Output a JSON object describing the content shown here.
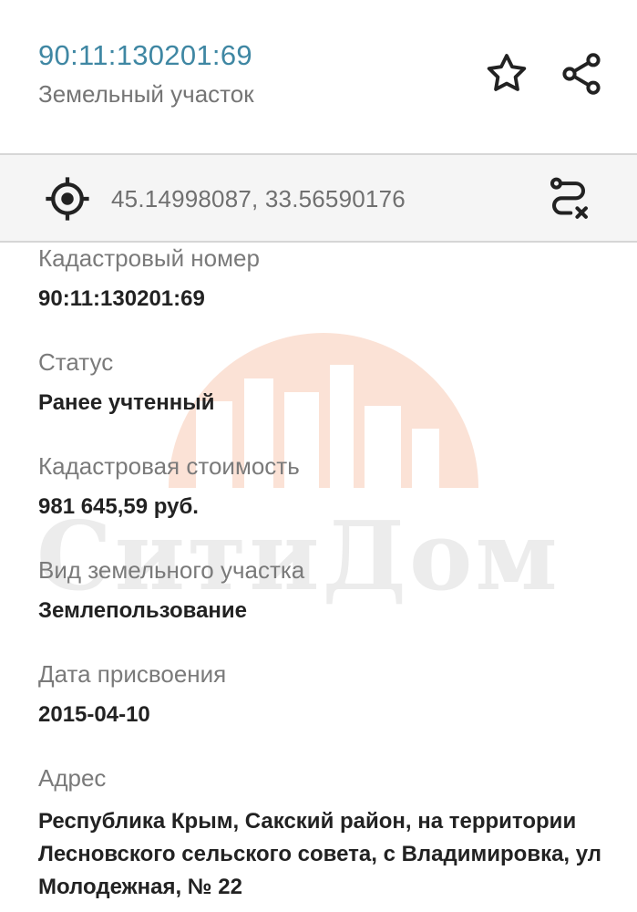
{
  "header": {
    "cadastral_id": "90:11:130201:69",
    "object_type": "Земельный участок"
  },
  "icons": {
    "favorite": "star-icon",
    "share": "share-icon",
    "locate": "crosshair-icon",
    "route": "route-icon"
  },
  "coords": {
    "text": "45.14998087, 33.56590176"
  },
  "watermark": {
    "text": "СитиДом"
  },
  "fields": [
    {
      "label": "Кадастровый номер",
      "value": "90:11:130201:69"
    },
    {
      "label": "Статус",
      "value": "Ранее учтенный"
    },
    {
      "label": "Кадастровая стоимость",
      "value": "981 645,59 руб."
    },
    {
      "label": "Вид земельного участка",
      "value": "Землепользование"
    },
    {
      "label": "Дата присвоения",
      "value": "2015-04-10"
    },
    {
      "label": "Адрес",
      "value": "Республика Крым, Сакский район, на территории Лесновского сельского совета, с Владимировка, ул Молодежная, № 22"
    }
  ],
  "colors": {
    "accent": "#3f87a3",
    "watermark_orange": "#fbe2d6"
  }
}
